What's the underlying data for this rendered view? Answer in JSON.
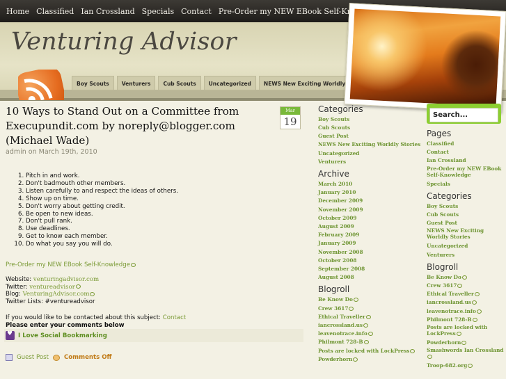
{
  "nav": [
    "Home",
    "Classified",
    "Ian Crossland",
    "Specials",
    "Contact",
    "Pre-Order my NEW EBook Self-Knowledge"
  ],
  "site_title": "Venturing Advisor",
  "category_tabs": [
    "Boy Scouts",
    "Venturers",
    "Cub Scouts",
    "Uncategorized",
    "NEWS New Exciting Worldly Stories"
  ],
  "search": {
    "placeholder": "Search..."
  },
  "post": {
    "title": "10 Ways to Stand Out on a Committee from Execupundit.com by noreply@blogger.com (Michael Wade)",
    "meta": "admin on March 19th, 2010",
    "date_month": "Mar",
    "date_day": "19",
    "list": [
      "Pitch in and work.",
      "Don't badmouth other members.",
      "Listen carefully to and respect the ideas of others.",
      "Show up on time.",
      "Don't worry about getting credit.",
      "Be open to new ideas.",
      "Don't pull rank.",
      "Use deadlines.",
      "Get to know each member.",
      "Do what you say you will do."
    ],
    "preorder_link": "Pre-Order my NEW EBook Self-Knowledge",
    "website_label": "Website:",
    "website": "venturingadvisor.com",
    "twitter_label": "Twitter:",
    "twitter": "ventureadvisor",
    "blog_label": "Blog:",
    "blog": "VenturingAdvisor.com",
    "twitter_lists": "Twitter Lists: #ventureadvisor",
    "if_contact": "If you would like to be contacted about this subject:",
    "contact_link": "Contact",
    "comment_prompt": "Please enter your comments below",
    "bookmark": "I Love Social Bookmarking",
    "footer_author": "Guest Post",
    "footer_comments": "Comments Off"
  },
  "sidebar1": {
    "categories_title": "Categories",
    "categories": [
      "Boy Scouts",
      "Cub Scouts",
      "Guest Post",
      "NEWS New Exciting Worldly Stories",
      "Uncategorized",
      "Venturers"
    ],
    "archive_title": "Archive",
    "archive": [
      "March 2010",
      "January 2010",
      "December 2009",
      "November 2009",
      "October 2009",
      "August 2009",
      "February 2009",
      "January 2009",
      "November 2008",
      "October 2008",
      "September 2008",
      "August 2008"
    ],
    "blogroll_title": "Blogroll",
    "blogroll": [
      "Be Know Do",
      "Crew 3617",
      "Ethical Traveller",
      "iancrossland.us",
      "leavenotrace.info",
      "Philmont 728-B",
      "Posts are locked with LockPress",
      "Powderhorn"
    ]
  },
  "sidebar2": {
    "pages_title": "Pages",
    "pages": [
      "Classified",
      "Contact",
      "Ian Crossland",
      "Pre-Order my NEW EBook Self-Knowledge",
      "Specials"
    ],
    "categories_title": "Categories",
    "categories": [
      "Boy Scouts",
      "Cub Scouts",
      "Guest Post",
      "NEWS New Exciting Worldly Stories",
      "Uncategorized",
      "Venturers"
    ],
    "blogroll_title": "Blogroll",
    "blogroll": [
      "Be Know Do",
      "Crew 3617",
      "Ethical Traveller",
      "iancrossland.us",
      "leavenotrace.info",
      "Philmont 728-B",
      "Posts are locked with LockPress",
      "Powderhorn",
      "Smashwords Ian Crossland",
      "Troop-682.org"
    ]
  }
}
